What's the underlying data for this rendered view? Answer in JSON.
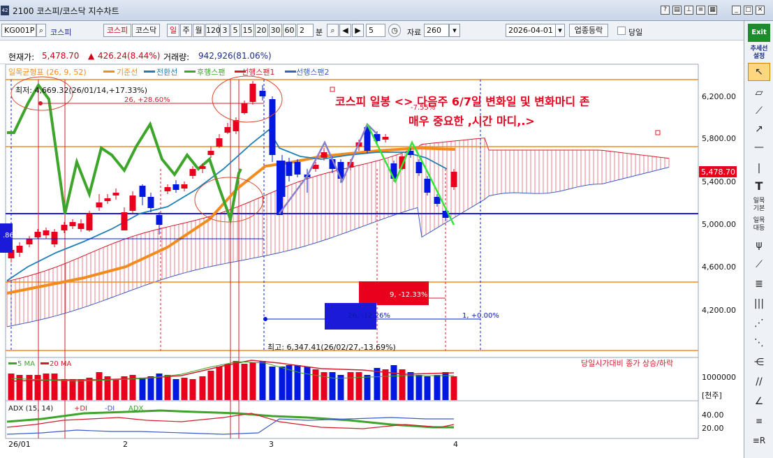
{
  "window": {
    "title": "2100 코스피/코스닥 지수차트",
    "badge": "42"
  },
  "toolbar": {
    "code": "KG001P",
    "name": "코스피",
    "market_buttons": [
      "코스피",
      "코스닥"
    ],
    "periods": [
      "일",
      "주",
      "월",
      "120",
      "3",
      "5",
      "15",
      "20",
      "30",
      "60"
    ],
    "minutes_value": "2",
    "minutes_label": "분",
    "count_value": "5",
    "data_label": "자료",
    "data_value": "260",
    "date_value": "2026-04-01",
    "industry_button": "업종등락",
    "today_label": "당일"
  },
  "info": {
    "price_label": "현재가:",
    "price_value": "5,478.70",
    "change_value": "426.24(8.44%)",
    "volume_label": "거래량:",
    "volume_value": "942,926(81.06%)"
  },
  "legend": {
    "ichimoku": "일목균형표 (26, 9, 52)",
    "items": [
      "기준선",
      "전환선",
      "후행스팬",
      "선행스팬1",
      "선행스팬2"
    ]
  },
  "annotations": {
    "low_label": "최저: 4,669.32(26/01/14,+17.33%)",
    "measure1": "26, +28.60%",
    "measure2": "9, -12.33%",
    "measure3": "26, -12.26%",
    "measure4": "1, +0.00%",
    "measure5": "-7.55%",
    "high_label": "최고: 6,347.41(26/02/27,-13.69%)",
    "left_pct": ".86%",
    "headline_1": "코스피 일봉 <> 다음주 6/7일  변화일 및 변화마디 존",
    "headline_2": "매우 중요한 ,시간 마디,.>",
    "current_tag": "5,478.70"
  },
  "price_axis": [
    "6,200.00",
    "5,800.00",
    "5,400.00",
    "5,000.00",
    "4,600.00",
    "4,200.00"
  ],
  "volume_panel": {
    "legend_5": "5 MA",
    "legend_20": "20 MA",
    "note": "당일시가대비 종가 상승/하락",
    "axis_value": "1000000",
    "unit": "[천주]"
  },
  "adx_panel": {
    "label": "ADX (15, 14)",
    "plus_di": "+DI",
    "minus_di": "-DI",
    "adx": "ADX",
    "axis": [
      "40.00",
      "20.00"
    ]
  },
  "date_axis": [
    "26/01",
    "2",
    "3",
    "4"
  ],
  "side_tools": {
    "exit": "Exit",
    "trend": "추세선\n설정",
    "ichimoku_basic": "일목\n기본",
    "ichimoku_big": "일목\n대등"
  },
  "colors": {
    "up": "#e8001c",
    "down": "#0018e0",
    "base_line": "#f28c1e",
    "conversion_line": "#1e7fb8",
    "lagging_span": "#3ca52a",
    "span1": "#d41b2b",
    "span2": "#3a5bc9"
  }
}
